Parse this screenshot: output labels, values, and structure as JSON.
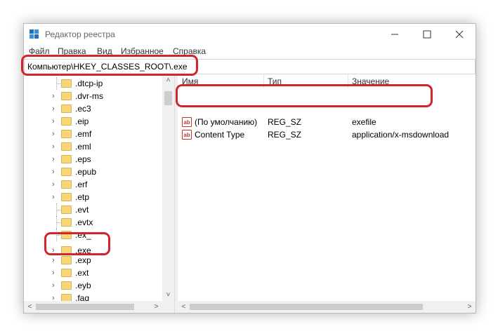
{
  "window": {
    "title": "Редактор реестра",
    "icon": "regedit-icon"
  },
  "window_controls": {
    "minimize": "—",
    "maximize": "☐",
    "close": "✕"
  },
  "menu": [
    "Файл",
    "Правка",
    "Вид",
    "Избранное",
    "Справка"
  ],
  "address": "Компьютер\\HKEY_CLASSES_ROOT\\.exe",
  "tree": {
    "items": [
      {
        "label": ".dtcp-ip",
        "expandable": false
      },
      {
        "label": ".dvr-ms",
        "expandable": true
      },
      {
        "label": ".ec3",
        "expandable": true
      },
      {
        "label": ".eip",
        "expandable": true
      },
      {
        "label": ".emf",
        "expandable": true
      },
      {
        "label": ".eml",
        "expandable": true
      },
      {
        "label": ".eps",
        "expandable": true
      },
      {
        "label": ".epub",
        "expandable": true
      },
      {
        "label": ".erf",
        "expandable": true
      },
      {
        "label": ".etp",
        "expandable": true
      },
      {
        "label": ".evt",
        "expandable": false
      },
      {
        "label": ".evtx",
        "expandable": false
      },
      {
        "label": ".ex_",
        "expandable": false
      },
      {
        "label": ".exe",
        "expandable": true,
        "selected": true
      },
      {
        "label": ".exp",
        "expandable": true
      },
      {
        "label": ".ext",
        "expandable": true
      },
      {
        "label": ".eyb",
        "expandable": true
      },
      {
        "label": ".faq",
        "expandable": true
      }
    ]
  },
  "values_table": {
    "headers": [
      "Имя",
      "Тип",
      "Значение"
    ],
    "rows": [
      {
        "name": "(По умолчанию)",
        "type": "REG_SZ",
        "value": "exefile",
        "icon": "ab-string-icon"
      },
      {
        "name": "Content Type",
        "type": "REG_SZ",
        "value": "application/x-msdownload",
        "icon": "ab-string-icon"
      }
    ]
  },
  "scroll_arrows": {
    "up": "˄",
    "down": "˅",
    "left": "<",
    "right": ">"
  },
  "colors": {
    "highlight": "#d0262b",
    "folder": "#f6d67a"
  }
}
